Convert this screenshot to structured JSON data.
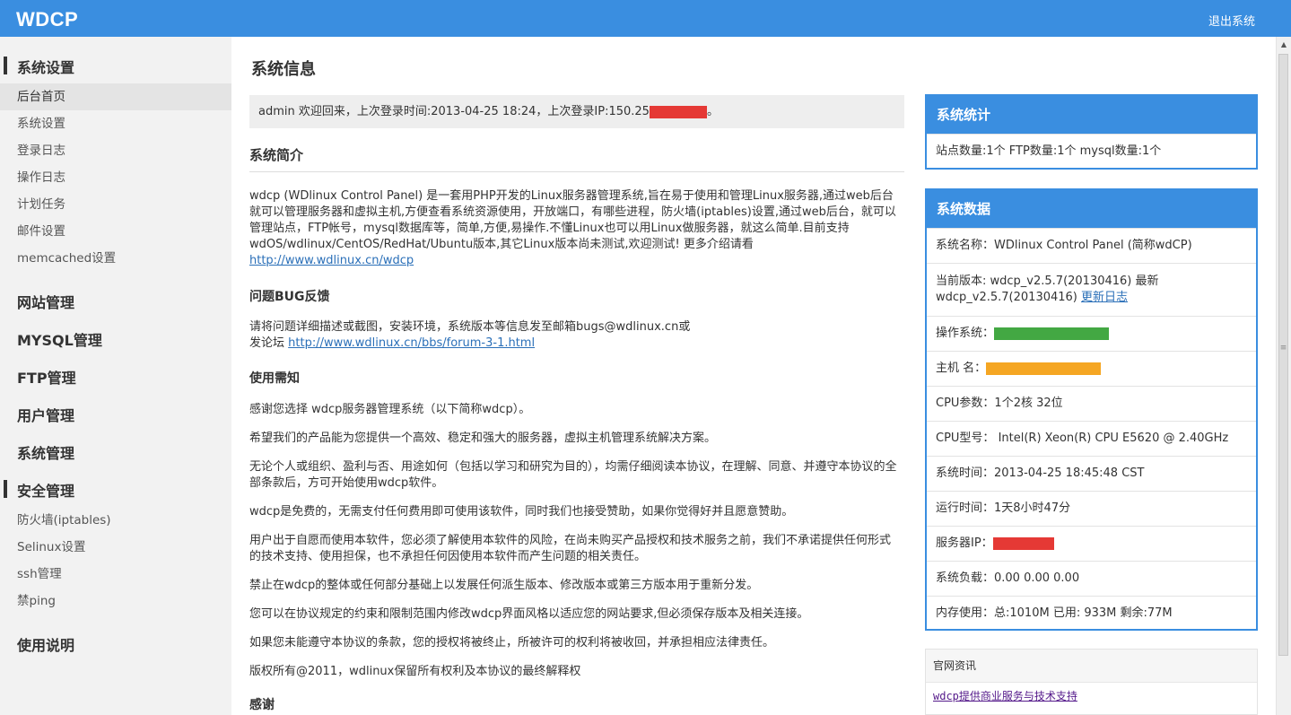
{
  "header": {
    "logo": "WDCP",
    "logout": "退出系统"
  },
  "sidebar": {
    "groups": [
      {
        "label": "系统设置",
        "items": [
          "后台首页",
          "系统设置",
          "登录日志",
          "操作日志",
          "计划任务",
          "邮件设置",
          "memcached设置"
        ]
      },
      {
        "label": "网站管理"
      },
      {
        "label": "MYSQL管理"
      },
      {
        "label": "FTP管理"
      },
      {
        "label": "用户管理"
      },
      {
        "label": "系统管理"
      },
      {
        "label": "安全管理",
        "items": [
          "防火墙(iptables)",
          "Selinux设置",
          "ssh管理",
          "禁ping"
        ]
      },
      {
        "label": "使用说明"
      }
    ]
  },
  "main": {
    "title": "系统信息",
    "welcome_prefix": "admin 欢迎回来，上次登录时间:2013-04-25 18:24，上次登录IP:150.25",
    "welcome_suffix": "。",
    "intro_heading": "系统简介",
    "intro_text": "wdcp (WDlinux Control Panel) 是一套用PHP开发的Linux服务器管理系统,旨在易于使用和管理Linux服务器,通过web后台就可以管理服务器和虚拟主机,方便查看系统资源使用，开放端口，有哪些进程，防火墙(iptables)设置,通过web后台，就可以管理站点，FTP帐号，mysql数据库等，简单,方便,易操作.不懂Linux也可以用Linux做服务器，就这么简单.目前支持wdOS/wdlinux/CentOS/RedHat/Ubuntu版本,其它Linux版本尚未测试,欢迎测试! 更多介绍请看",
    "intro_link": "http://www.wdlinux.cn/wdcp",
    "bug_heading": "问题BUG反馈",
    "bug_text": "请将问题详细描述或截图，安装环境，系统版本等信息发至邮箱bugs@wdlinux.cn或",
    "bug_text2": "发论坛 ",
    "bug_link": "http://www.wdlinux.cn/bbs/forum-3-1.html",
    "notice_heading": "使用需知",
    "notice": [
      "感谢您选择 wdcp服务器管理系统（以下简称wdcp）。",
      "希望我们的产品能为您提供一个高效、稳定和强大的服务器，虚拟主机管理系统解决方案。",
      "无论个人或组织、盈利与否、用途如何（包括以学习和研究为目的），均需仔细阅读本协议，在理解、同意、并遵守本协议的全部条款后，方可开始使用wdcp软件。",
      "wdcp是免费的，无需支付任何费用即可使用该软件，同时我们也接受赞助，如果你觉得好并且愿意赞助。",
      "用户出于自愿而使用本软件，您必须了解使用本软件的风险，在尚未购买产品授权和技术服务之前，我们不承诺提供任何形式的技术支持、使用担保，也不承担任何因使用本软件而产生问题的相关责任。",
      "禁止在wdcp的整体或任何部分基础上以发展任何派生版本、修改版本或第三方版本用于重新分发。",
      "您可以在协议规定的约束和限制范围内修改wdcp界面风格以适应您的网站要求,但必须保存版本及相关连接。",
      "如果您未能遵守本协议的条款，您的授权将被终止，所被许可的权利将被收回，并承担相应法律责任。",
      "版权所有@2011，wdlinux保留所有权利及本协议的最终解释权"
    ],
    "thanks_heading": "感谢"
  },
  "stats": {
    "title": "系统统计",
    "text": "站点数量:1个  FTP数量:1个  mysql数量:1个"
  },
  "sysdata": {
    "title": "系统数据",
    "name": "系统名称：WDlinux Control Panel (简称wdCP)",
    "version": "当前版本: wdcp_v2.5.7(20130416) 最新 wdcp_v2.5.7(20130416)",
    "changelog": "更新日志",
    "os_label": "操作系统：",
    "host_label": "主机 名：",
    "cpu_param": "CPU参数：1个2核 32位",
    "cpu_model": "CPU型号：  Intel(R) Xeon(R) CPU E5620 @ 2.40GHz",
    "sys_time": "系统时间：2013-04-25 18:45:48 CST",
    "uptime": "运行时间：1天8小时47分",
    "ip_label": "服务器IP：",
    "load": "系统负载：0.00   0.00   0.00",
    "memory": "内存使用：总:1010M   已用: 933M   剩余:77M"
  },
  "news": {
    "title": "官网资讯",
    "item": "wdcp提供商业服务与技术支持"
  },
  "colors": {
    "accent": "#3a8ee0",
    "redact_red": "#e53935",
    "redact_green": "#43a843",
    "redact_orange": "#f5a623"
  },
  "icons": [
    "scroll-up-icon",
    "scroll-grip-icon"
  ]
}
